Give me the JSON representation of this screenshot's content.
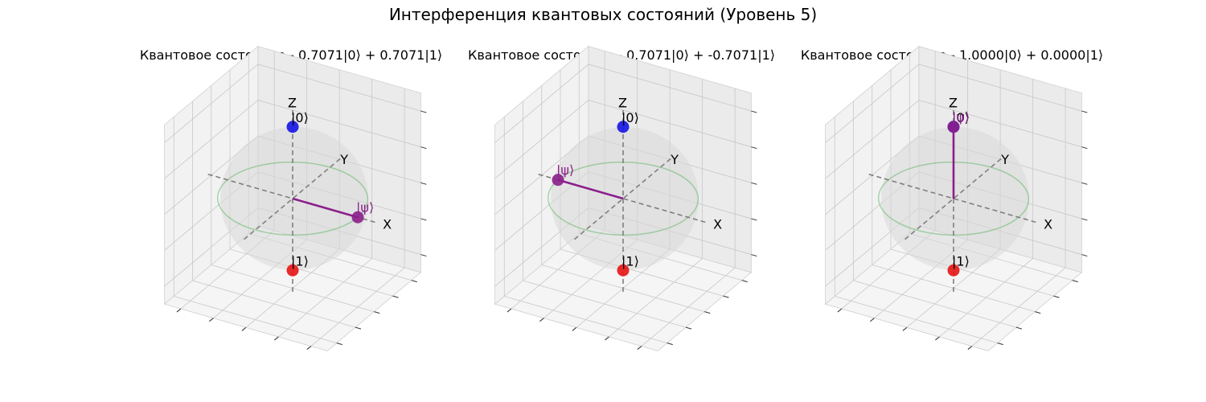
{
  "figure": {
    "title": "Интерференция квантовых состояний (Уровень 5)"
  },
  "colors": {
    "state0": "#1f1fe6",
    "state1": "#e61f1f",
    "psi": "#8b1f8b",
    "equator": "#4caf50",
    "sphere": "#d8d8d8",
    "axis": "#7f7f7f"
  },
  "chart_data": [
    {
      "type": "scatter",
      "subplot_kind": "bloch-sphere-3d",
      "title": "Квантовое состояние - 0.7071|0⟩ + 0.7071|1⟩",
      "axis_labels": {
        "x": "X",
        "y": "Y",
        "z": "Z"
      },
      "points": [
        {
          "label": "|0⟩",
          "x": 0,
          "y": 0,
          "z": 1
        },
        {
          "label": "|1⟩",
          "x": 0,
          "y": 0,
          "z": -1
        }
      ],
      "state_vector": {
        "label": "|ψ⟩",
        "x": 1,
        "y": 0,
        "z": 0
      },
      "xlim": [
        -1.2,
        1.2
      ],
      "ylim": [
        -1.2,
        1.2
      ],
      "zlim": [
        -1.2,
        1.2
      ],
      "grid": true,
      "tick_labels": false
    },
    {
      "type": "scatter",
      "subplot_kind": "bloch-sphere-3d",
      "title": "Квантовое состояние - 0.7071|0⟩ + -0.7071|1⟩",
      "axis_labels": {
        "x": "X",
        "y": "Y",
        "z": "Z"
      },
      "points": [
        {
          "label": "|0⟩",
          "x": 0,
          "y": 0,
          "z": 1
        },
        {
          "label": "|1⟩",
          "x": 0,
          "y": 0,
          "z": -1
        }
      ],
      "state_vector": {
        "label": "|ψ⟩",
        "x": -1,
        "y": 0,
        "z": 0
      },
      "xlim": [
        -1.2,
        1.2
      ],
      "ylim": [
        -1.2,
        1.2
      ],
      "zlim": [
        -1.2,
        1.2
      ],
      "grid": true,
      "tick_labels": false
    },
    {
      "type": "scatter",
      "subplot_kind": "bloch-sphere-3d",
      "title": "Квантовое состояние - 1.0000|0⟩ + 0.0000|1⟩",
      "axis_labels": {
        "x": "X",
        "y": "Y",
        "z": "Z"
      },
      "points": [
        {
          "label": "|0⟩",
          "x": 0,
          "y": 0,
          "z": 1
        },
        {
          "label": "|1⟩",
          "x": 0,
          "y": 0,
          "z": -1
        }
      ],
      "state_vector": {
        "label": "|ψ⟩",
        "x": 0,
        "y": 0,
        "z": 1
      },
      "xlim": [
        -1.2,
        1.2
      ],
      "ylim": [
        -1.2,
        1.2
      ],
      "zlim": [
        -1.2,
        1.2
      ],
      "grid": true,
      "tick_labels": false
    }
  ]
}
